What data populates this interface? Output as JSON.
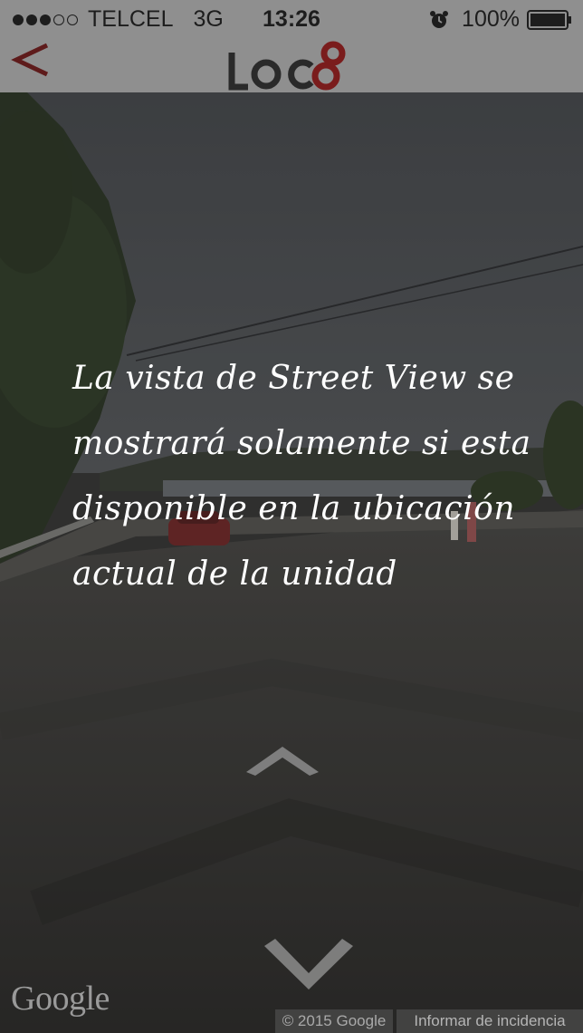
{
  "status_bar": {
    "signal_full": 3,
    "signal_empty": 2,
    "carrier": "TELCEL",
    "network": "3G",
    "time": "13:26",
    "battery": "100%"
  },
  "header": {
    "back_icon": "chevron-left-icon",
    "logo_text": "LOC8",
    "logo_accent_color": "#7a1c1c"
  },
  "street_view": {
    "message": "La vista de Street View se mostrará solamente si esta disponible en la ubicación actual de la unidad",
    "google_logo": "Google",
    "copyright": "© 2015 Google",
    "report_link": "Informar de incidencia"
  }
}
